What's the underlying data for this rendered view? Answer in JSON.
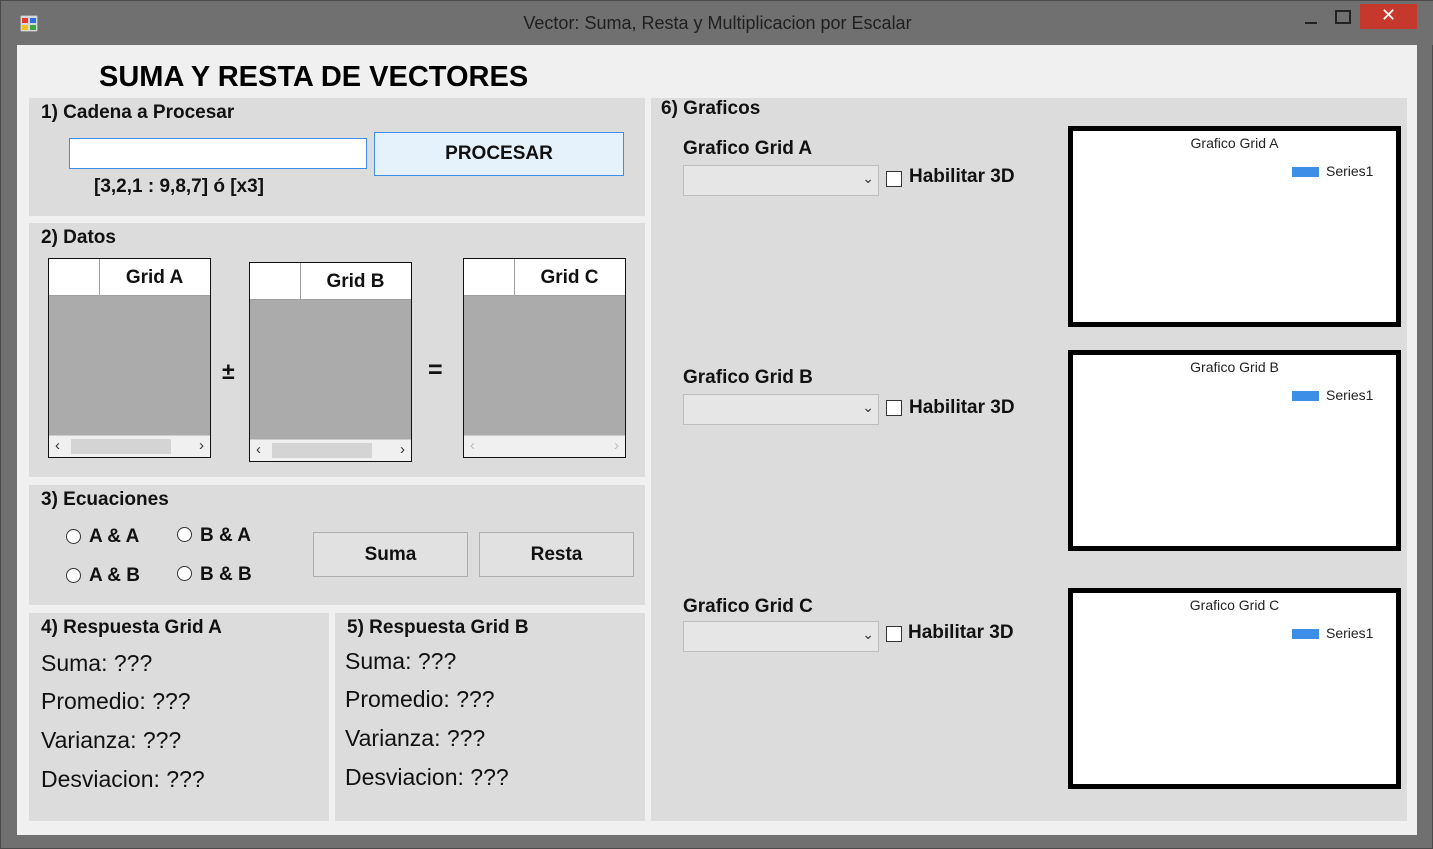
{
  "window": {
    "title": "Vector: Suma, Resta y Multiplicacion por Escalar",
    "close_glyph": "✕",
    "accent_close": "#c7382c"
  },
  "main_title": "SUMA Y RESTA DE VECTORES",
  "section1": {
    "heading": "1) Cadena a Procesar",
    "input_value": "",
    "process_button": "PROCESAR",
    "hint": "[3,2,1 : 9,8,7] ó [x3]"
  },
  "section2": {
    "heading": "2) Datos",
    "grids": [
      {
        "title": "Grid A"
      },
      {
        "title": "Grid B"
      },
      {
        "title": "Grid C"
      }
    ],
    "op_plusminus": "±",
    "op_equals": "="
  },
  "section3": {
    "heading": "3) Ecuaciones",
    "options": [
      "A & A",
      "B & A",
      "A & B",
      "B & B"
    ],
    "suma_button": "Suma",
    "resta_button": "Resta"
  },
  "section4": {
    "heading": "4) Respuesta Grid A",
    "suma": "Suma: ???",
    "promedio": "Promedio: ???",
    "varianza": "Varianza: ???",
    "desviacion": "Desviacion: ???"
  },
  "section5": {
    "heading": "5) Respuesta Grid B",
    "suma": "Suma: ???",
    "promedio": "Promedio: ???",
    "varianza": "Varianza: ???",
    "desviacion": "Desviacion: ???"
  },
  "section6": {
    "heading": "6) Graficos",
    "items": [
      {
        "label": "Grafico Grid A",
        "check": "Habilitar 3D",
        "chart_title": "Grafico Grid A",
        "legend": "Series1"
      },
      {
        "label": "Grafico Grid B",
        "check": "Habilitar 3D",
        "chart_title": "Grafico Grid B",
        "legend": "Series1"
      },
      {
        "label": "Grafico Grid C",
        "check": "Habilitar 3D",
        "chart_title": "Grafico Grid C",
        "legend": "Series1"
      }
    ],
    "series_color": "#3c8ee6"
  },
  "icons": {
    "scroll_left": "‹",
    "scroll_right": "›",
    "dropdown": "⌄"
  }
}
